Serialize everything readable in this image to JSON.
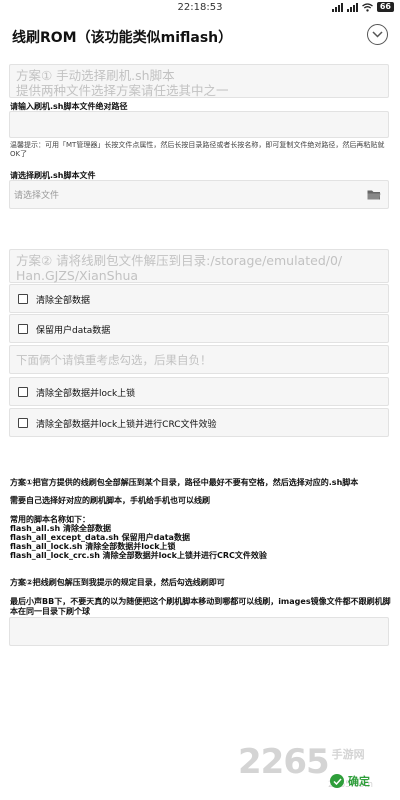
{
  "status_bar": {
    "time": "22:18:53",
    "battery": "66"
  },
  "header": {
    "title": "线刷ROM（该功能类似miflash）"
  },
  "plan1": {
    "text": "方案①  手动选择刷机.sh脚本\n提供两种文件选择方案请任选其中之一"
  },
  "path_input": {
    "label": "请输入刷机.sh脚本文件绝对路径",
    "value": "",
    "hint": "温馨提示：可用「MT管理器」长按文件点属性，然后长按目录路径或者长按名称，即可复制文件绝对路径，然后再粘贴就OK了"
  },
  "file_select": {
    "label": "请选择刷机.sh脚本文件",
    "placeholder": "请选择文件"
  },
  "plan2": {
    "text": "方案②  请将线刷包文件解压到目录:/storage/emulated/0/\nHan.GJZS/XianShua"
  },
  "options": [
    {
      "label": "清除全部数据"
    },
    {
      "label": "保留用户data数据"
    }
  ],
  "warning": "下面俩个请慎重考虑勾选，后果自负！",
  "options_danger": [
    {
      "label": "清除全部数据并lock上锁"
    },
    {
      "label": "清除全部数据并lock上锁并进行CRC文件效验"
    }
  ],
  "info": {
    "p1": "方案①把官方提供的线刷包全部解压到某个目录，路径中最好不要有空格，然后选择对应的.sh脚本",
    "p2": "需要自己选择好对应的刷机脚本，手机给手机也可以线刷",
    "p3_title": "常用的脚本名称如下：",
    "scripts": [
      "flash_all.sh 清除全部数据",
      "flash_all_except_data.sh 保留用户data数据",
      "flash_all_lock.sh 清除全部数据并lock上锁",
      "flash_all_lock_crc.sh 清除全部数据并lock上锁并进行CRC文件效验"
    ],
    "p4": "方案②把线刷包解压到我提示的规定目录，然后勾选线刷即可",
    "p5": "最后小声BB下，不要天真的以为随便把这个刷机脚本移动到哪都可以线刷，images镜像文件都不跟刷机脚本在同一目录下刷个球"
  },
  "bottom_input": {
    "value": ""
  },
  "confirm": {
    "label": "确定"
  },
  "watermark": {
    "number": "2265",
    "text": "手游网",
    "url": "2265.com"
  },
  "colors": {
    "accent": "#2e9e3a",
    "box_bg": "#f6f6f6",
    "placeholder": "#c2c2c2"
  }
}
